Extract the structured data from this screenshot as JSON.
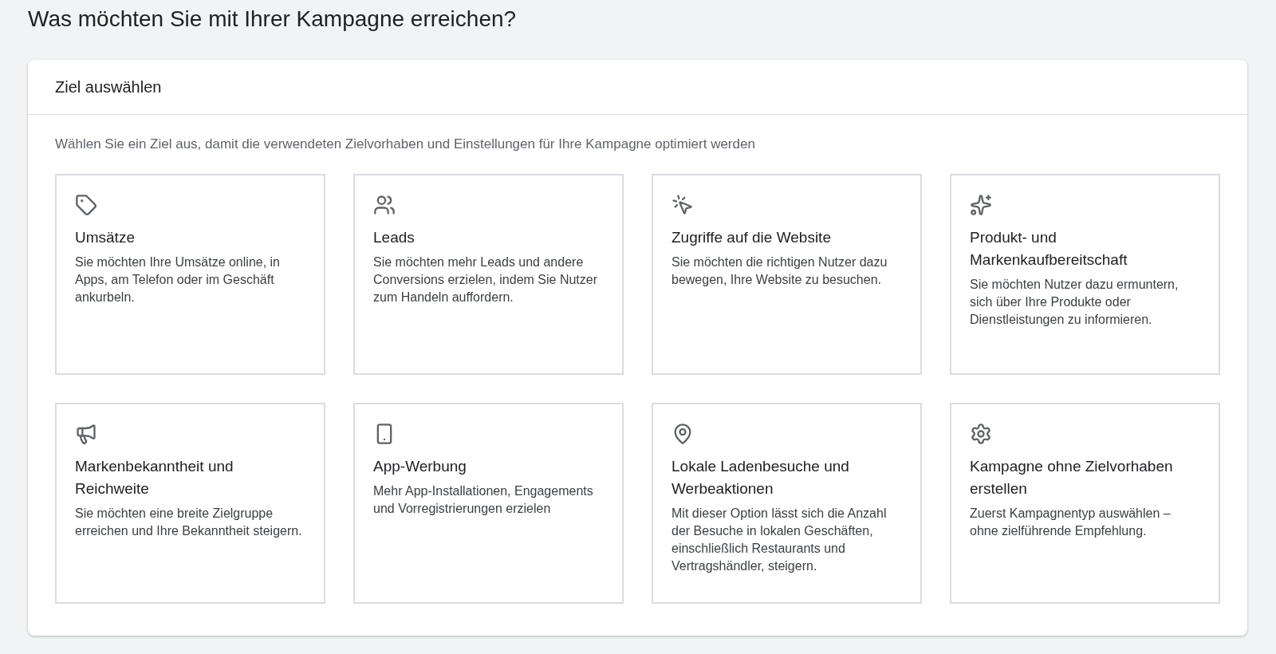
{
  "page_title": "Was möchten Sie mit Ihrer Kampagne erreichen?",
  "panel": {
    "title": "Ziel auswählen",
    "description": "Wählen Sie ein Ziel aus, damit die verwendeten Zielvorhaben und Einstellungen für Ihre Kampagne optimiert werden",
    "goals": [
      {
        "title": "Umsätze",
        "description": "Sie möchten Ihre Umsätze online, in Apps, am Telefon oder im Geschäft ankurbeln."
      },
      {
        "title": "Leads",
        "description": "Sie möchten mehr Leads und andere Conversions erzielen, indem Sie Nutzer zum Handeln auffordern."
      },
      {
        "title": "Zugriffe auf die Website",
        "description": "Sie möchten die richtigen Nutzer dazu bewegen, Ihre Website zu besuchen."
      },
      {
        "title": "Produkt- und Markenkaufbereitschaft",
        "description": "Sie möchten Nutzer dazu ermuntern, sich über Ihre Produkte oder Dienstleistungen zu informieren."
      },
      {
        "title": "Markenbekanntheit und Reichweite",
        "description": "Sie möchten eine breite Zielgruppe erreichen und Ihre Bekanntheit steigern."
      },
      {
        "title": "App-Werbung",
        "description": "Mehr App-Installationen, Engagements und Vorregistrierungen erzielen"
      },
      {
        "title": "Lokale Ladenbesuche und Werbeaktionen",
        "description": "Mit dieser Option lässt sich die Anzahl der Besuche in lokalen Geschäften, einschließlich Restaurants und Vertragshändler, steigern."
      },
      {
        "title": "Kampagne ohne Zielvorhaben erstellen",
        "description": "Zuerst Kampagnentyp auswählen – ohne zielführende Empfehlung."
      }
    ]
  }
}
